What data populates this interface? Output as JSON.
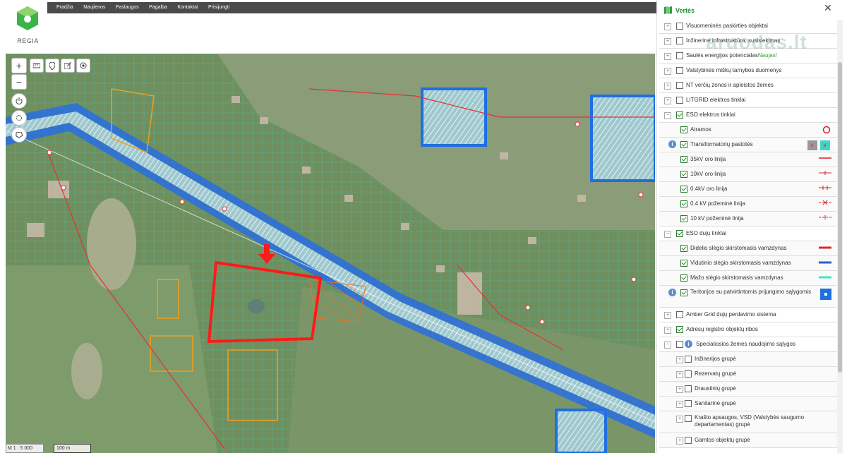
{
  "brand": {
    "name": "REGIA"
  },
  "nav": {
    "items": [
      "Pradžia",
      "Naujienos",
      "Paslaugos",
      "Pagalba",
      "Kontaktai",
      "Prisijungti"
    ]
  },
  "map": {
    "scale_text": "M 1 : 5 000",
    "scale_bar_text": "100 m",
    "controls": [
      "zoom-in-icon",
      "zoom-out-icon",
      "measure-icon",
      "marker-icon",
      "export-icon",
      "locate-icon",
      "power-icon",
      "settings-icon",
      "shape-icon"
    ],
    "colors": {
      "highlight": "#ff1a1a",
      "parcel": "#3fd6d6",
      "road": "#1e6fe0",
      "arrow": "#ff1a1a"
    }
  },
  "panel": {
    "title": "Vertės",
    "watermark": "aruodas.lt",
    "layers": [
      {
        "label": "Visuomeninės paskirties objektai",
        "checked": false,
        "expandable": true
      },
      {
        "label": "Inžinerinė infrastruktūra, susisiekimas",
        "checked": false,
        "expandable": true
      },
      {
        "label": "Saulės energijos potencialas",
        "badge": "Naujas!",
        "checked": false,
        "expandable": true
      },
      {
        "label": "Valstybinės miškų tarnybos duomenys",
        "checked": false,
        "expandable": true
      },
      {
        "label": "NT verčių zonos ir apleistos žemės",
        "checked": false,
        "expandable": true
      },
      {
        "label": "LITGRID elektros tinklai",
        "checked": false,
        "expandable": true
      },
      {
        "label": "ESO elektros tinklai",
        "checked": true,
        "expandable": true,
        "collapse": true
      },
      {
        "label": "Atramos",
        "checked": true,
        "sub": true,
        "symbol": "circle-red-icon"
      },
      {
        "label": "Transformatorių pastotės",
        "checked": true,
        "sub": true,
        "info": true,
        "symbol": "substation-icon"
      },
      {
        "label": "35kV oro linija",
        "checked": true,
        "sub": true,
        "symbol": "line-35kv-icon"
      },
      {
        "label": "10kV oro linija",
        "checked": true,
        "sub": true,
        "symbol": "line-10kv-icon"
      },
      {
        "label": "0.4kV oro linija",
        "checked": true,
        "sub": true,
        "symbol": "line-04kv-icon"
      },
      {
        "label": "0.4 kV požeminė linija",
        "checked": true,
        "sub": true,
        "symbol": "underground-04-icon"
      },
      {
        "label": "10 kV požeminė linija",
        "checked": true,
        "sub": true,
        "symbol": "underground-10-icon"
      },
      {
        "label": "ESO dujų tinklai",
        "checked": true,
        "expandable": true,
        "collapse": true
      },
      {
        "label": "Didelio slėgio skirstomasis vamzdynas",
        "checked": true,
        "sub": true,
        "symbol": "pipe-high-icon",
        "color": "#d62a2a"
      },
      {
        "label": "Vidutinio slėgio skirstomasis vamzdynas",
        "checked": true,
        "sub": true,
        "symbol": "pipe-mid-icon",
        "color": "#2a5fd6"
      },
      {
        "label": "Mažo slėgio skirstomasis vamzdynas",
        "checked": true,
        "sub": true,
        "symbol": "pipe-low-icon",
        "color": "#3ee8c8"
      },
      {
        "label": "Teritorijos su patvirtintomis prijungimo sąlygomis",
        "checked": true,
        "sub": true,
        "info": true,
        "tall": true,
        "symbol": "territory-icon"
      },
      {
        "label": "Amber Grid dujų perdavimo sistema",
        "checked": false,
        "expandable": true
      },
      {
        "label": "Adresų registro objektų ribos",
        "checked": true,
        "expandable": true
      },
      {
        "label": "Specialiosios žemės naudojimo sąlygos",
        "checked": false,
        "expandable": true,
        "collapse": true,
        "info": true
      },
      {
        "label": "Inžinerijos grupė",
        "checked": false,
        "sub2": true
      },
      {
        "label": "Rezervatų grupė",
        "checked": false,
        "sub2": true
      },
      {
        "label": "Draustinių grupė",
        "checked": false,
        "sub2": true
      },
      {
        "label": "Sanitarinė grupė",
        "checked": false,
        "sub2": true
      },
      {
        "label": "Krašto apsaugos, VSD (Valstybės saugumo departamentas) grupė",
        "checked": false,
        "sub2": true,
        "tall": true
      },
      {
        "label": "Gamtos objektų grupė",
        "checked": false,
        "sub2": true
      }
    ]
  }
}
